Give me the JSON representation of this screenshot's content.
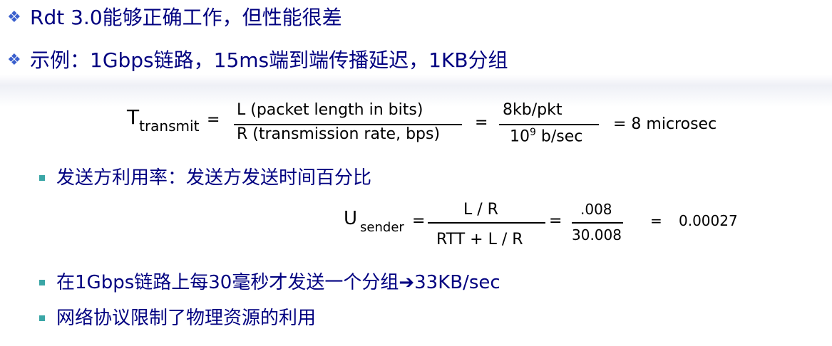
{
  "bullets": {
    "b1": "Rdt 3.0能够正确工作，但性能很差",
    "b2": "示例：1Gbps链路，15ms端到端传播延迟，1KB分组"
  },
  "transmit_formula": {
    "lhs_main": "T",
    "lhs_sub": "transmit",
    "eq1": "=",
    "num1": "L (packet length in bits)",
    "den1": "R (transmission rate, bps)",
    "eq2": "=",
    "num2": "8kb/pkt",
    "den2_base": "10",
    "den2_exp": "9",
    "den2_rest": " b/sec",
    "result": "= 8 microsec"
  },
  "sub_bullets": {
    "sb1": "发送方利用率：发送方发送时间百分比",
    "sb2_pre": "在1Gbps链路上每30毫秒才发送一个分组",
    "sb2_post": "33KB/sec",
    "sb3": "网络协议限制了物理资源的利用"
  },
  "util_formula": {
    "lhs_main": "U",
    "lhs_sub": "sender",
    "eq1": "=",
    "num1": "L / R",
    "den1": "RTT + L / R",
    "eq2": "=",
    "num2": ".008",
    "den2": "30.008",
    "eq3": "=",
    "result": "0.00027"
  }
}
